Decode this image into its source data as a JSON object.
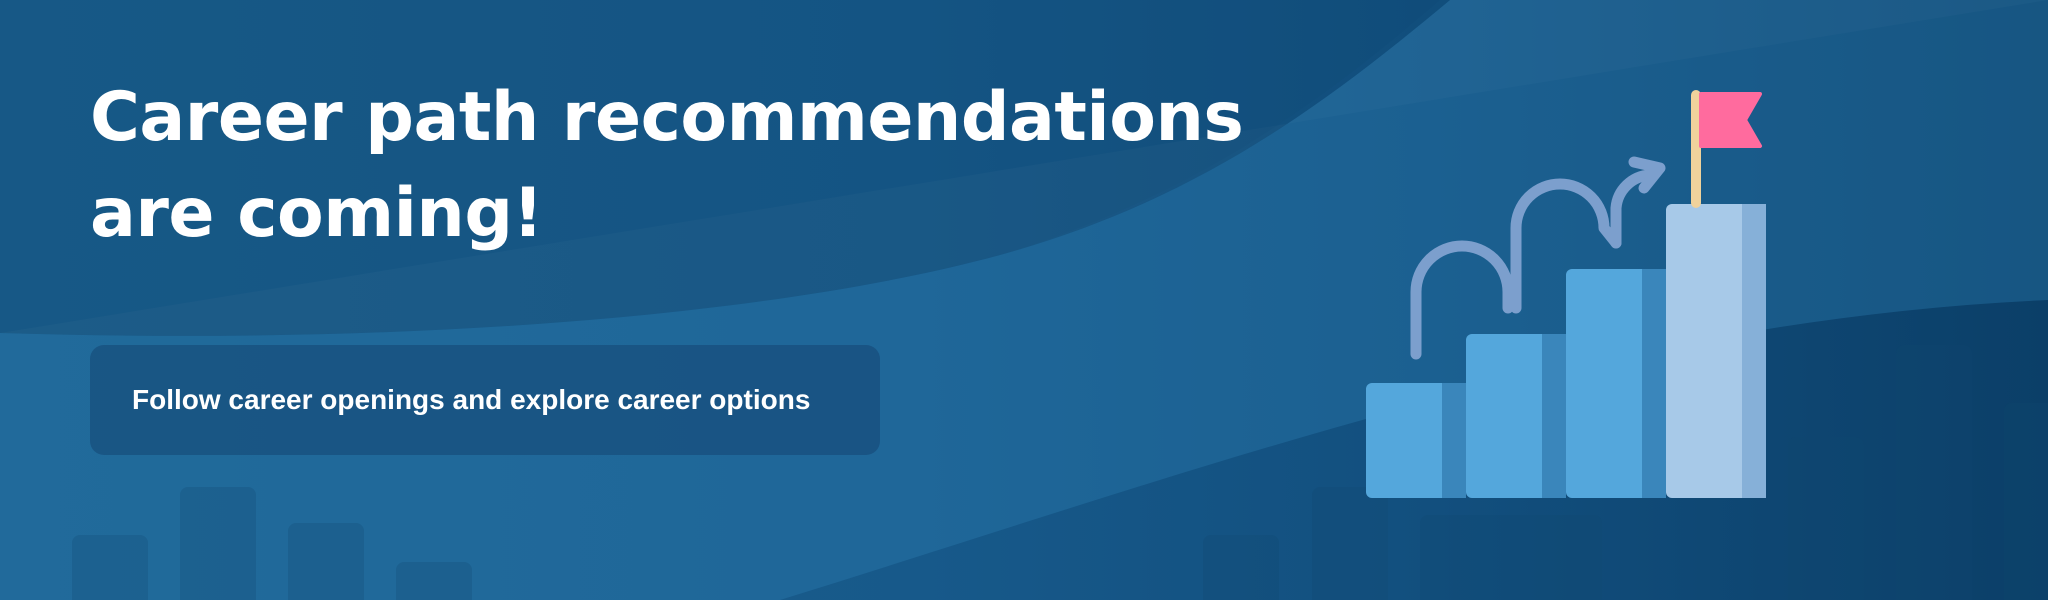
{
  "banner": {
    "headline_line1": "Career path recommendations",
    "headline_line2": "are coming!",
    "subtitle": "Follow career openings and explore career options"
  },
  "colors": {
    "background": "#17598a",
    "step_blue": "#54a7dc",
    "step_shadow": "#3a86bb",
    "top_step": "#a7c9e8",
    "arrow": "#7c9fcd",
    "flag": "#ff6b9e",
    "flagpole": "#f0d29c"
  },
  "icons": {
    "illustration": "career-stairs-flag-icon"
  }
}
